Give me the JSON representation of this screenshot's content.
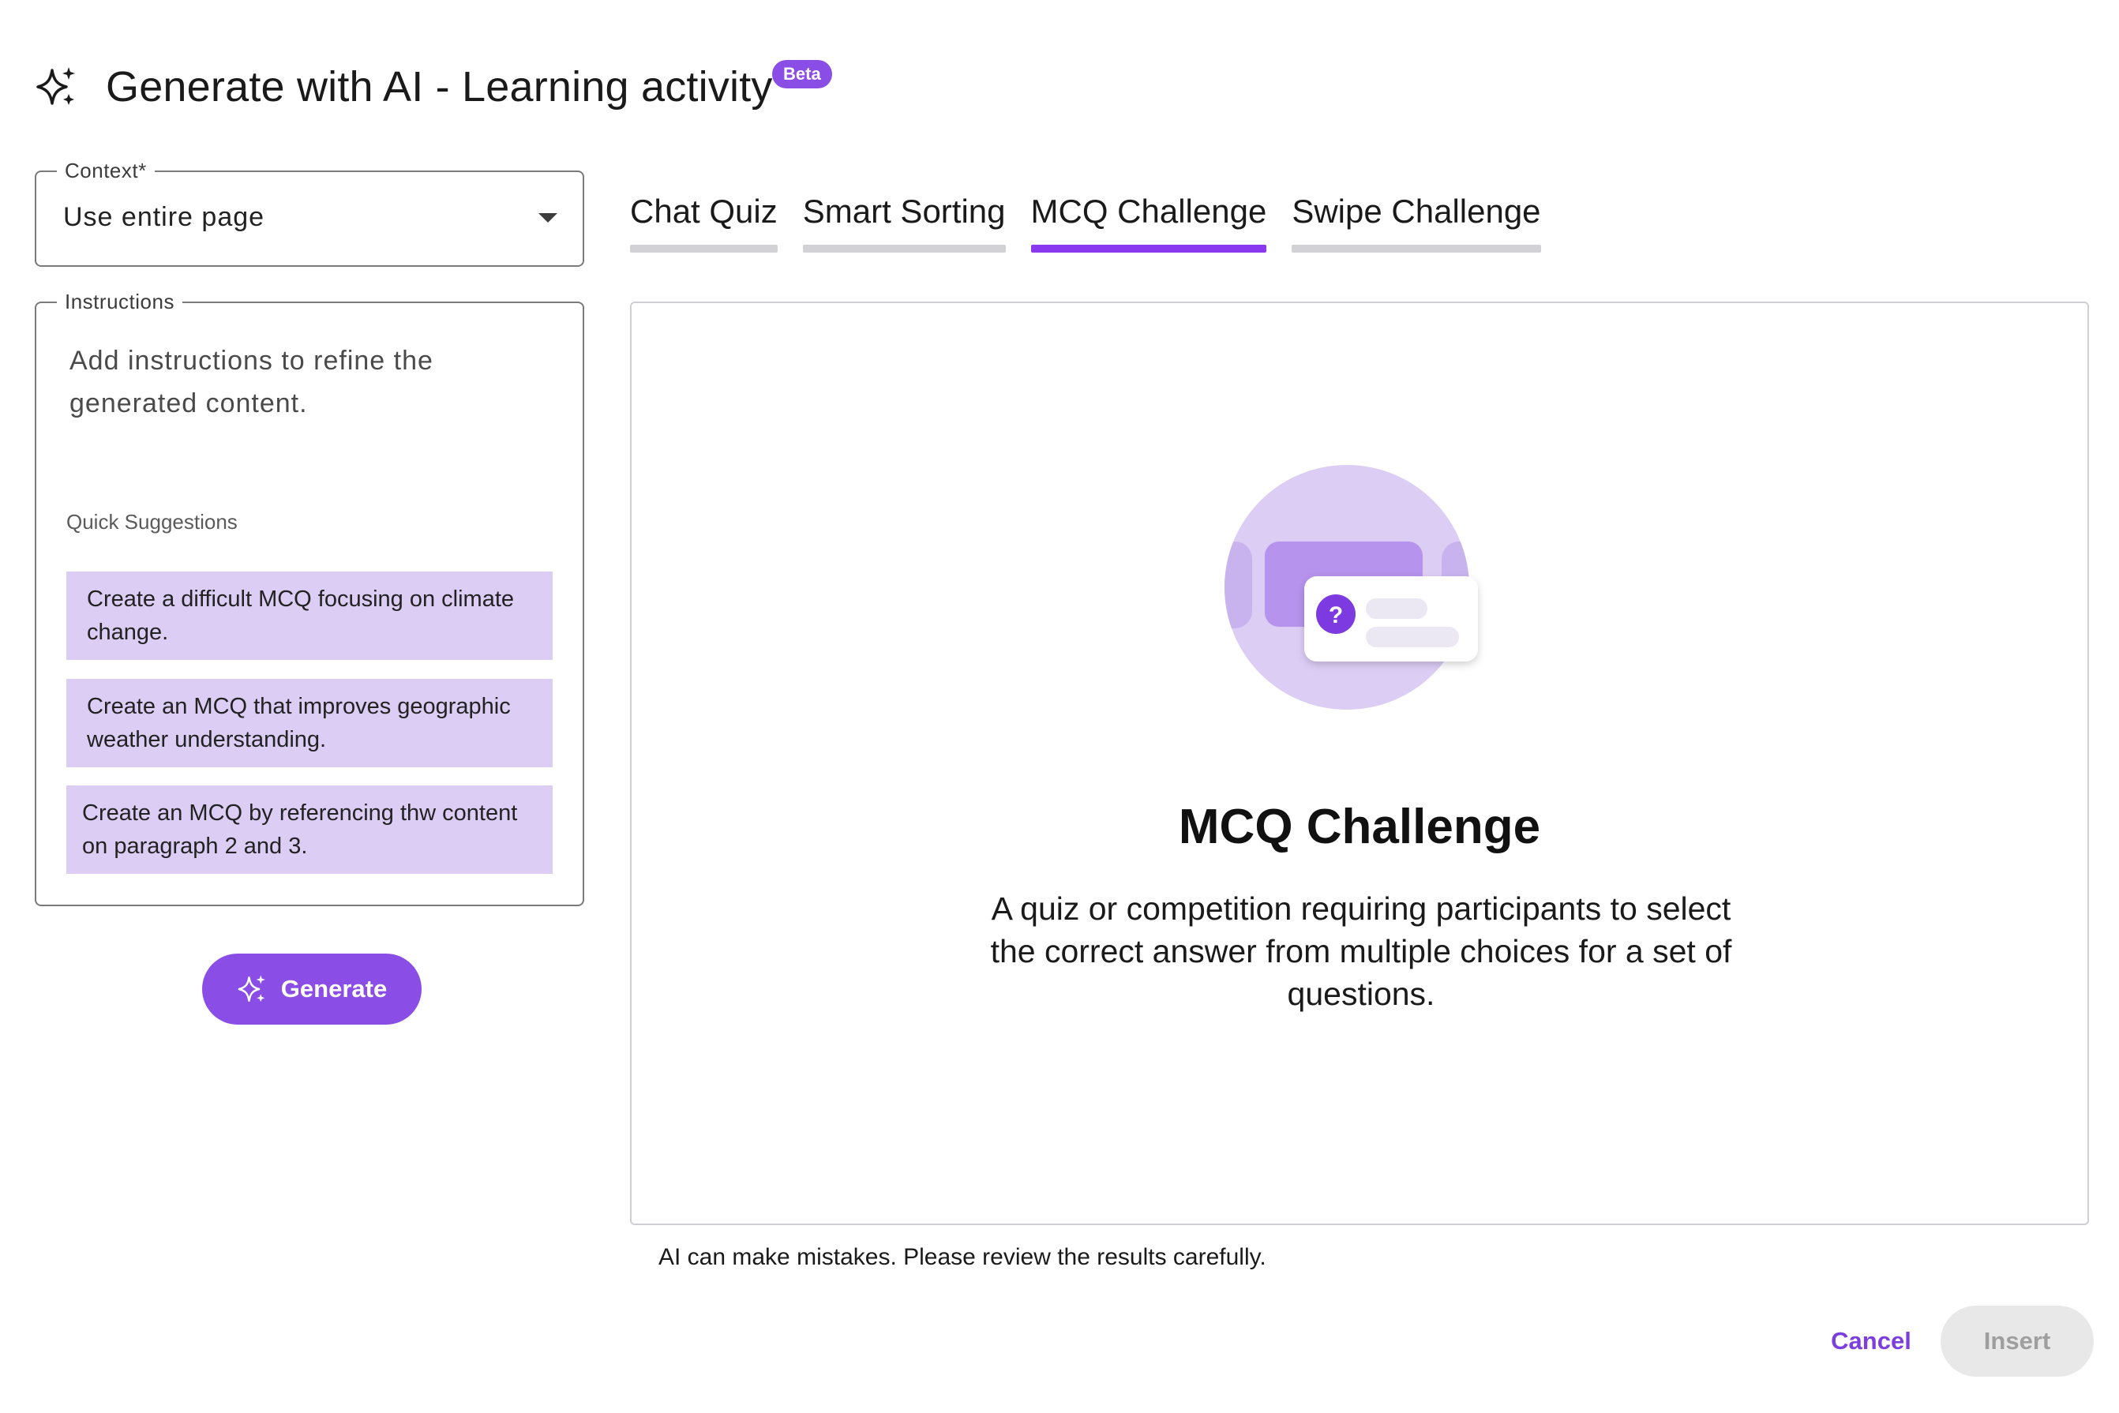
{
  "header": {
    "title": "Generate with AI - Learning activity",
    "badge": "Beta",
    "icon": "sparkle-icon"
  },
  "context": {
    "label": "Context*",
    "value": "Use entire page"
  },
  "instructions": {
    "label": "Instructions",
    "placeholder": "Add instructions to refine the generated content.",
    "quick_suggestions_label": "Quick Suggestions",
    "suggestions": [
      "Create a difficult MCQ focusing on climate change.",
      "Create an MCQ that improves geographic weather understanding.",
      "Create an MCQ by referencing thw content on paragraph 2 and 3."
    ]
  },
  "generate_label": "Generate",
  "tabs": [
    {
      "label": "Chat Quiz",
      "active": false
    },
    {
      "label": "Smart Sorting",
      "active": false
    },
    {
      "label": "MCQ Challenge",
      "active": true
    },
    {
      "label": "Swipe Challenge",
      "active": false
    }
  ],
  "panel": {
    "title": "MCQ Challenge",
    "description": "A quiz or competition requiring participants to select the correct answer from multiple choices for a set of questions.",
    "illustration_icon": "question-mark-icon"
  },
  "disclaimer": "AI can make mistakes. Please review the results carefully.",
  "actions": {
    "cancel_label": "Cancel",
    "insert_label": "Insert"
  },
  "colors": {
    "accent": "#8a4de6",
    "suggestion_bg": "#dccdf5",
    "tab_inactive_underline": "#d2d2d6",
    "tab_active_underline": "#8a38f0"
  }
}
